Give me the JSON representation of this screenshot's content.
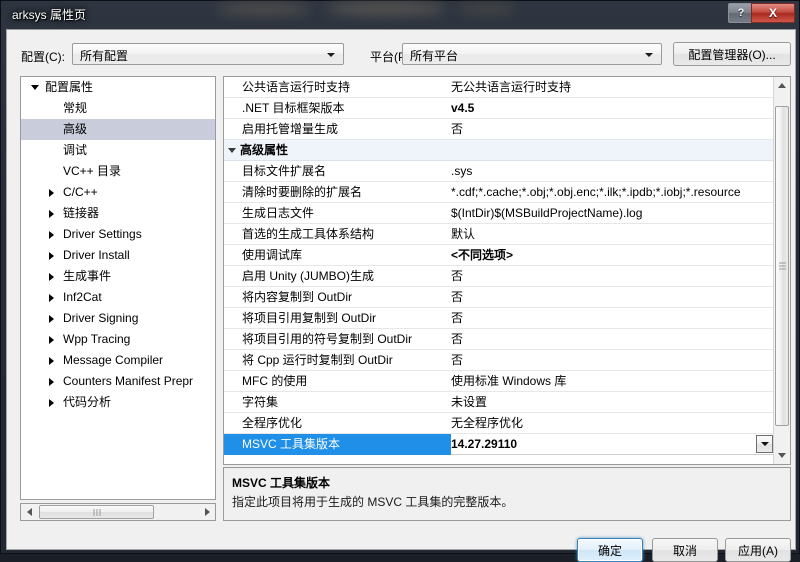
{
  "window": {
    "title": "arksys 属性页",
    "help_button": "?",
    "close_button": "X"
  },
  "toolbar": {
    "config_label": "配置(C):",
    "config_value": "所有配置",
    "platform_label": "平台(P):",
    "platform_value": "所有平台",
    "config_manager_button": "配置管理器(O)..."
  },
  "tree": {
    "items": [
      {
        "label": "配置属性",
        "indent": 0,
        "twisty": "expanded",
        "selected": false
      },
      {
        "label": "常规",
        "indent": 1,
        "twisty": "none",
        "selected": false
      },
      {
        "label": "高级",
        "indent": 1,
        "twisty": "none",
        "selected": true
      },
      {
        "label": "调试",
        "indent": 1,
        "twisty": "none",
        "selected": false
      },
      {
        "label": "VC++ 目录",
        "indent": 1,
        "twisty": "none",
        "selected": false
      },
      {
        "label": "C/C++",
        "indent": 1,
        "twisty": "collapsed",
        "selected": false
      },
      {
        "label": "链接器",
        "indent": 1,
        "twisty": "collapsed",
        "selected": false
      },
      {
        "label": "Driver Settings",
        "indent": 1,
        "twisty": "collapsed",
        "selected": false
      },
      {
        "label": "Driver Install",
        "indent": 1,
        "twisty": "collapsed",
        "selected": false
      },
      {
        "label": "生成事件",
        "indent": 1,
        "twisty": "collapsed",
        "selected": false
      },
      {
        "label": "Inf2Cat",
        "indent": 1,
        "twisty": "collapsed",
        "selected": false
      },
      {
        "label": "Driver Signing",
        "indent": 1,
        "twisty": "collapsed",
        "selected": false
      },
      {
        "label": "Wpp Tracing",
        "indent": 1,
        "twisty": "collapsed",
        "selected": false
      },
      {
        "label": "Message Compiler",
        "indent": 1,
        "twisty": "collapsed",
        "selected": false
      },
      {
        "label": "Counters Manifest Prepr",
        "indent": 1,
        "twisty": "collapsed",
        "selected": false
      },
      {
        "label": "代码分析",
        "indent": 1,
        "twisty": "collapsed",
        "selected": false
      }
    ]
  },
  "grid": {
    "rows": [
      {
        "name": "公共语言运行时支持",
        "value": "无公共语言运行时支持",
        "group": false,
        "bold": false,
        "selected": false
      },
      {
        "name": ".NET 目标框架版本",
        "value": "v4.5",
        "group": false,
        "bold": true,
        "selected": false
      },
      {
        "name": "启用托管增量生成",
        "value": "否",
        "group": false,
        "bold": false,
        "selected": false
      },
      {
        "name": "高级属性",
        "value": "",
        "group": true,
        "bold": false,
        "selected": false
      },
      {
        "name": "目标文件扩展名",
        "value": ".sys",
        "group": false,
        "bold": false,
        "selected": false
      },
      {
        "name": "清除时要删除的扩展名",
        "value": "*.cdf;*.cache;*.obj;*.obj.enc;*.ilk;*.ipdb;*.iobj;*.resource",
        "group": false,
        "bold": false,
        "selected": false
      },
      {
        "name": "生成日志文件",
        "value": "$(IntDir)$(MSBuildProjectName).log",
        "group": false,
        "bold": false,
        "selected": false
      },
      {
        "name": "首选的生成工具体系结构",
        "value": "默认",
        "group": false,
        "bold": false,
        "selected": false
      },
      {
        "name": "使用调试库",
        "value": "<不同选项>",
        "group": false,
        "bold": true,
        "selected": false
      },
      {
        "name": "启用 Unity (JUMBO)生成",
        "value": "否",
        "group": false,
        "bold": false,
        "selected": false
      },
      {
        "name": "将内容复制到 OutDir",
        "value": "否",
        "group": false,
        "bold": false,
        "selected": false
      },
      {
        "name": "将项目引用复制到 OutDir",
        "value": "否",
        "group": false,
        "bold": false,
        "selected": false
      },
      {
        "name": "将项目引用的符号复制到 OutDir",
        "value": "否",
        "group": false,
        "bold": false,
        "selected": false
      },
      {
        "name": "将 Cpp 运行时复制到 OutDir",
        "value": "否",
        "group": false,
        "bold": false,
        "selected": false
      },
      {
        "name": "MFC 的使用",
        "value": "使用标准 Windows 库",
        "group": false,
        "bold": false,
        "selected": false
      },
      {
        "name": "字符集",
        "value": "未设置",
        "group": false,
        "bold": false,
        "selected": false
      },
      {
        "name": "全程序优化",
        "value": "无全程序优化",
        "group": false,
        "bold": false,
        "selected": false
      },
      {
        "name": "MSVC 工具集版本",
        "value": "14.27.29110",
        "group": false,
        "bold": true,
        "selected": true
      }
    ]
  },
  "description": {
    "title": "MSVC 工具集版本",
    "body": "指定此项目将用于生成的 MSVC 工具集的完整版本。"
  },
  "footer": {
    "ok": "确定",
    "cancel": "取消",
    "apply": "应用(A)"
  },
  "colors": {
    "selection_blue": "#1f8fe8",
    "tree_selection": "#c9ccdb",
    "group_row": "#eff3fa",
    "dialog_bg": "#f0f0f0"
  }
}
